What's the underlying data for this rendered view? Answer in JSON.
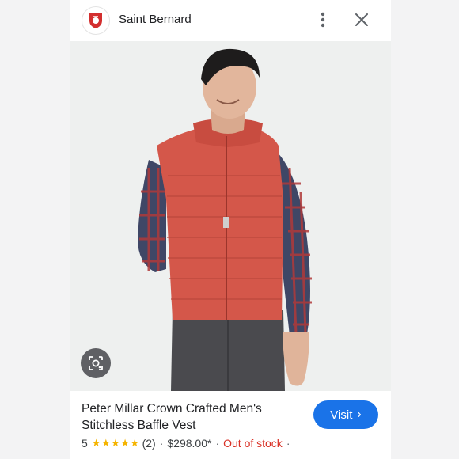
{
  "header": {
    "site_name": "Saint Bernard",
    "icons": {
      "site": "shield-logo-icon",
      "more": "more-vertical-icon",
      "close": "close-icon"
    }
  },
  "product": {
    "title": "Peter Millar Crown Crafted Men's Stitchless Baffle Vest",
    "rating": "5",
    "stars": "★★★★★",
    "review_count": "(2)",
    "price": "$298.00*",
    "separator": "·",
    "availability": "Out of stock"
  },
  "actions": {
    "visit_label": "Visit",
    "visit_chevron": "›"
  },
  "colors": {
    "accent": "#1a73e8",
    "star": "#f5b400",
    "out_of_stock": "#d93025",
    "vest": "#d4574a"
  }
}
